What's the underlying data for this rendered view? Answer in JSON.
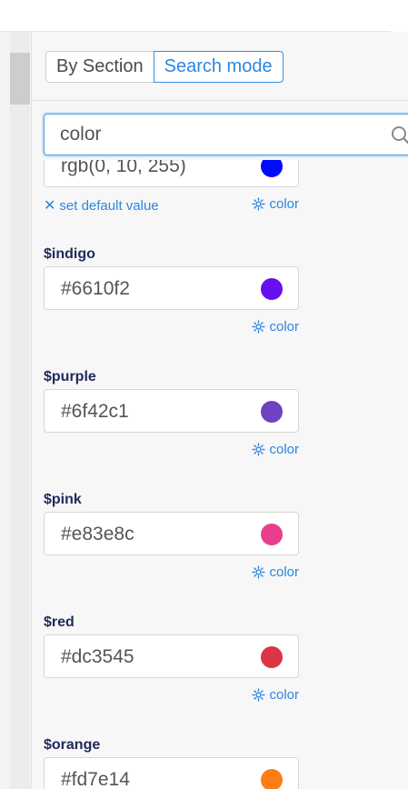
{
  "mode_switch": {
    "by_section_label": "By Section",
    "search_mode_label": "Search mode"
  },
  "search": {
    "value": "color",
    "icon": "search-icon"
  },
  "fields": [
    {
      "name": "",
      "value": "rgb(0, 10, 255)",
      "swatch": "#000aff",
      "reset_label": "set default value",
      "tag": "color"
    },
    {
      "name": "$indigo",
      "value": "#6610f2",
      "swatch": "#6610f2",
      "reset_label": "",
      "tag": "color"
    },
    {
      "name": "$purple",
      "value": "#6f42c1",
      "swatch": "#6f42c1",
      "reset_label": "",
      "tag": "color"
    },
    {
      "name": "$pink",
      "value": "#e83e8c",
      "swatch": "#e83e8c",
      "reset_label": "",
      "tag": "color"
    },
    {
      "name": "$red",
      "value": "#dc3545",
      "swatch": "#dc3545",
      "reset_label": "",
      "tag": "color"
    },
    {
      "name": "$orange",
      "value": "#fd7e14",
      "swatch": "#fd7e14",
      "reset_label": "",
      "tag": ""
    }
  ],
  "colors": {
    "accent": "#2e86de",
    "var_name": "#1f2a5a"
  }
}
